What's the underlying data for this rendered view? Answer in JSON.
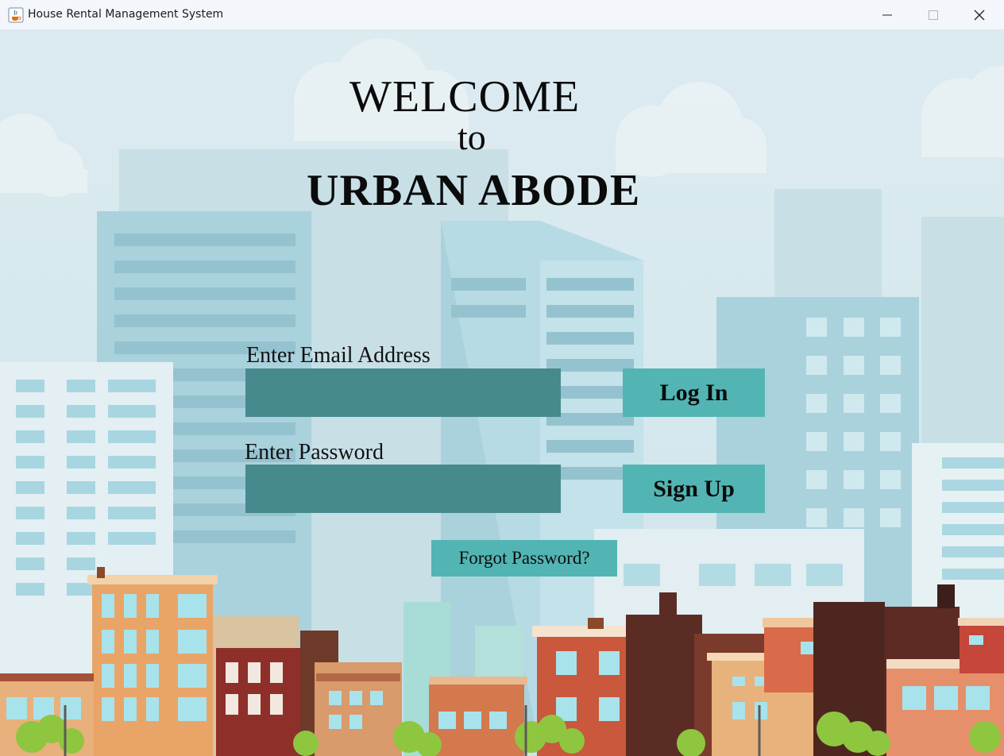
{
  "window": {
    "title": "House Rental Management System",
    "icon": "java-cup-icon",
    "controls": [
      "minimize-icon",
      "maximize-icon",
      "close-icon"
    ]
  },
  "welcome": {
    "line1": "WELCOME",
    "line2": "to",
    "line3": "URBAN ABODE"
  },
  "form": {
    "email_label": "Enter Email Address",
    "email_value": "",
    "password_label": "Enter Password",
    "password_value": "",
    "login_label": "Log In",
    "signup_label": "Sign Up",
    "forgot_label": "Forgot Password?"
  },
  "colors": {
    "input_bg": "#478a8e",
    "button_bg": "#52b5b3",
    "sky": "#dcebf0"
  }
}
